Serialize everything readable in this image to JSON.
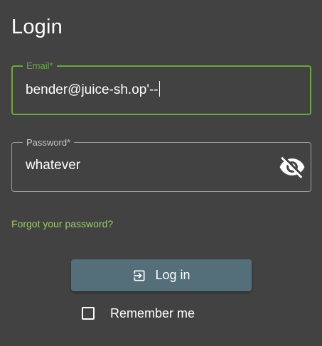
{
  "page": {
    "title": "Login"
  },
  "form": {
    "email": {
      "label": "Email*",
      "value": "bender@juice-sh.op'--"
    },
    "password": {
      "label": "Password*",
      "value": "whatever",
      "toggle_icon": "visibility-off-icon"
    },
    "forgot_password_link": "Forgot your password?",
    "login_button": {
      "label": "Log in",
      "icon": "login-icon"
    },
    "remember_me": {
      "label": "Remember me",
      "checked": false
    }
  },
  "colors": {
    "background": "#424242",
    "accent_green": "#69a83b",
    "link_green": "#9ccc65",
    "button": "#546e7a",
    "text": "#ffffff"
  }
}
